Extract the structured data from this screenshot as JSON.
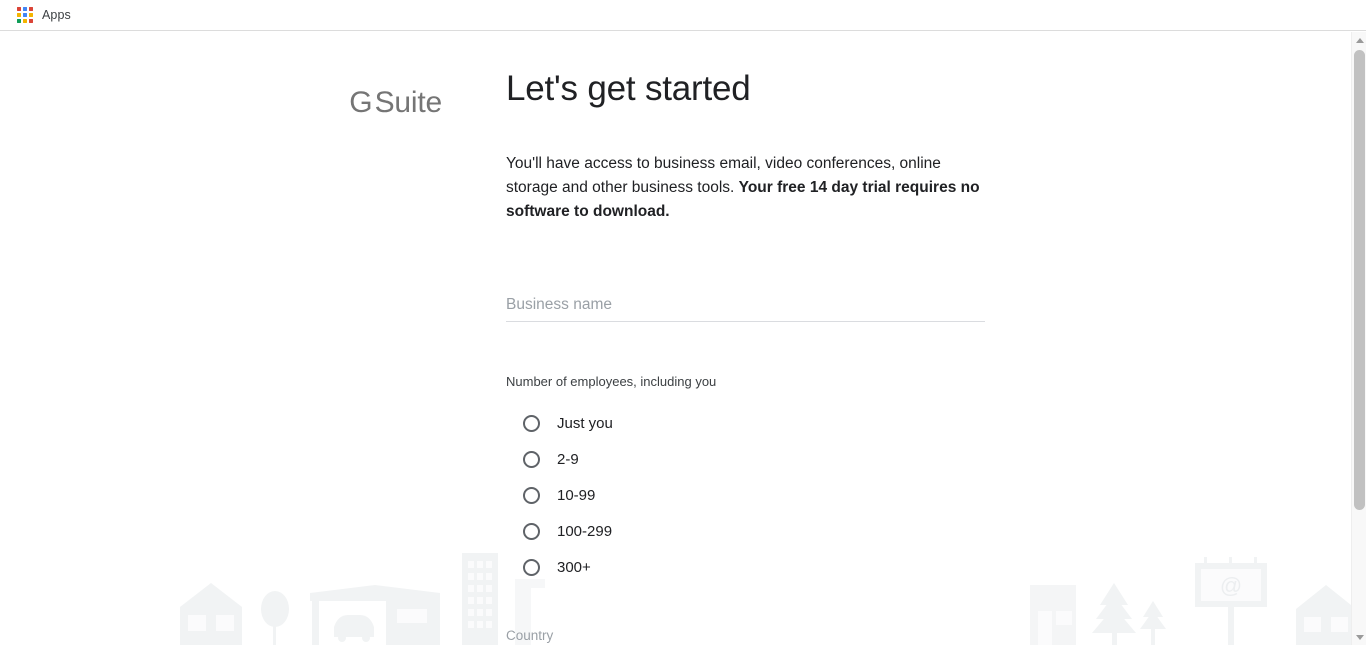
{
  "browser": {
    "bookmarks": [
      {
        "label": "Apps",
        "icon": "apps-grid-icon"
      }
    ],
    "apps_icon_colors": [
      "#DB4437",
      "#4285F4",
      "#DB4437",
      "#F4B400",
      "#4285F4",
      "#F4B400",
      "#0F9D58",
      "#F4B400",
      "#DB4437"
    ]
  },
  "page": {
    "brand": {
      "g": "G",
      "suite": "Suite",
      "full": "G Suite"
    },
    "title": "Let's get started",
    "intro": {
      "normal": "You'll have access to business email, video conferences, online storage and other business tools. ",
      "bold": "Your free 14 day trial requires no software to download."
    },
    "business_name_field": {
      "placeholder": "Business name",
      "value": ""
    },
    "employees": {
      "label": "Number of employees, including you",
      "options": [
        {
          "label": "Just you",
          "selected": false
        },
        {
          "label": "2-9",
          "selected": false
        },
        {
          "label": "10-99",
          "selected": false
        },
        {
          "label": "100-299",
          "selected": false
        },
        {
          "label": "300+",
          "selected": false
        }
      ]
    },
    "country_field": {
      "placeholder": "Country",
      "value": ""
    },
    "illustration": {
      "name": "cityscape-illustration",
      "elements": [
        "house",
        "tree",
        "garage-with-car",
        "office-tower",
        "signpost",
        "building",
        "pine-tree",
        "small-pine-tree",
        "billboard-at-symbol",
        "house"
      ],
      "billboard_glyph": "@",
      "color": "#f1f3f4"
    }
  },
  "scrollbar": {
    "up_arrow": "scroll-up-arrow",
    "down_arrow": "scroll-down-arrow",
    "thumb": "scroll-thumb"
  },
  "colors": {
    "text_primary": "#202124",
    "text_secondary": "#3c4043",
    "placeholder": "#9aa0a6",
    "logo_gray": "#757575",
    "divider": "#dadce0",
    "illustration": "#f1f3f4"
  }
}
